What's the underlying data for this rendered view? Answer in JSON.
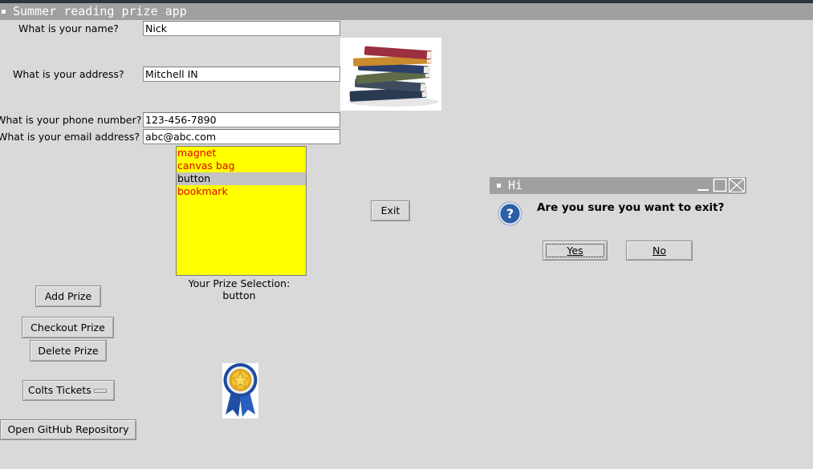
{
  "window": {
    "title": "Summer reading prize app"
  },
  "form": {
    "name_label": "What is your name?",
    "name_value": "Nick",
    "address_label": "What is your address?",
    "address_value": "Mitchell IN",
    "phone_label": "What is your phone number?",
    "phone_value": "123-456-7890",
    "email_label": "What is your email address?",
    "email_value": "abc@abc.com"
  },
  "prize_list": {
    "items": [
      "magnet",
      "canvas bag",
      "button",
      "bookmark"
    ],
    "selected": "button",
    "colors": {
      "background": "#ffff00",
      "text": "#e00000",
      "selected_bg": "#c3c3c3"
    }
  },
  "selection": {
    "label": "Your Prize Selection:",
    "value": "button"
  },
  "buttons": {
    "add_prize": "Add Prize",
    "checkout_prize": "Checkout Prize",
    "delete_prize": "Delete Prize",
    "colts_tickets": "Colts Tickets",
    "github": "Open GitHub Repository",
    "exit": "Exit"
  },
  "images": {
    "books": "books-stack-image",
    "medal": "award-ribbon-image"
  },
  "dialog": {
    "title": "Hi",
    "message": "Are you sure you want to exit?",
    "icon": "question-icon",
    "yes_label": "Yes",
    "no_label": "No"
  }
}
